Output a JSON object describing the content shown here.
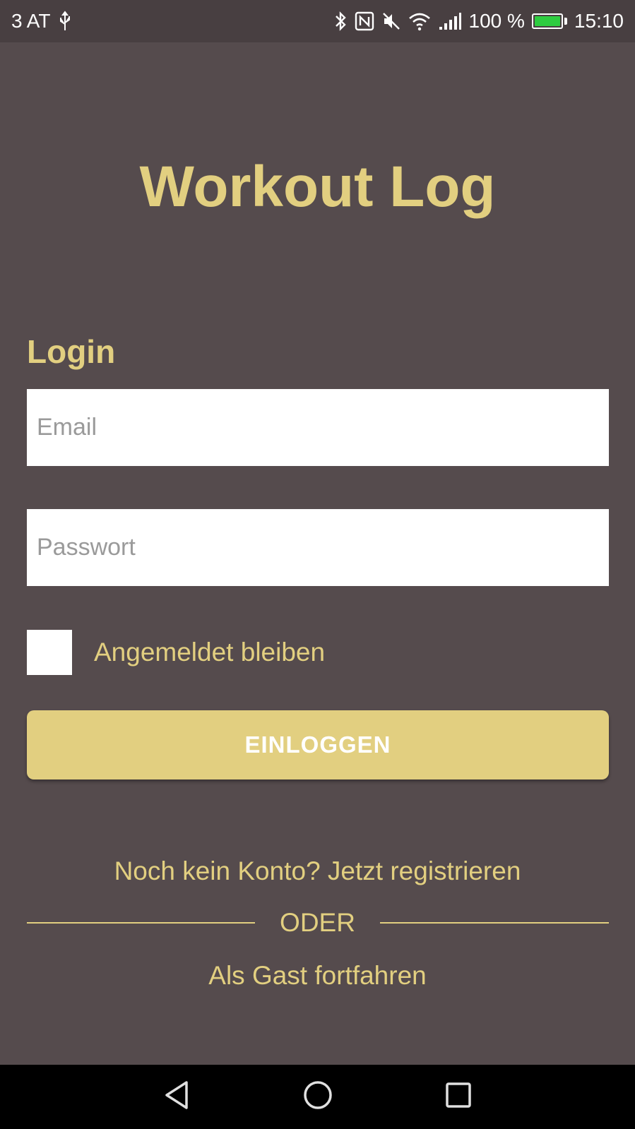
{
  "status_bar": {
    "carrier": "3 AT",
    "battery_percent": "100 %",
    "time": "15:10",
    "icons": [
      "usb-icon",
      "bluetooth-icon",
      "nfc-icon",
      "mute-icon",
      "wifi-icon",
      "signal-icon",
      "battery-charging-icon"
    ],
    "battery_color": "#2ecc40"
  },
  "app": {
    "title": "Workout Log"
  },
  "login": {
    "heading": "Login",
    "email_placeholder": "Email",
    "password_placeholder": "Passwort",
    "remember_label": "Angemeldet bleiben",
    "remember_checked": false,
    "button_label": "EINLOGGEN"
  },
  "links": {
    "register": "Noch kein Konto? Jetzt registrieren",
    "divider": "ODER",
    "guest": "Als Gast fortfahren"
  },
  "nav": {
    "icons": [
      "back-icon",
      "home-icon",
      "recent-apps-icon"
    ]
  },
  "colors": {
    "background": "#554b4d",
    "accent": "#e2cf80",
    "status_bar": "#483f41"
  }
}
